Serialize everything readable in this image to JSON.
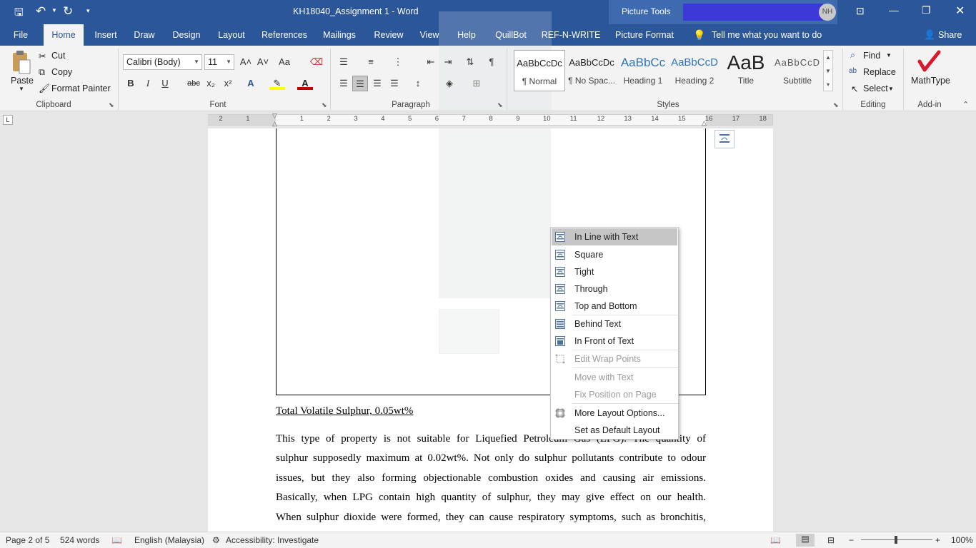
{
  "window": {
    "title": "KH18040_Assignment 1  -  Word",
    "context_tools": "Picture Tools",
    "user_initials": "NH"
  },
  "qat": {
    "save": "save-icon",
    "undo": "undo-icon",
    "redo": "redo-icon"
  },
  "tabs": [
    "File",
    "Home",
    "Insert",
    "Draw",
    "Design",
    "Layout",
    "References",
    "Mailings",
    "Review",
    "View",
    "Help",
    "QuillBot",
    "REF-N-WRITE",
    "Picture Format"
  ],
  "tell_me": "Tell me what you want to do",
  "share": "Share",
  "clipboard": {
    "paste": "Paste",
    "cut": "Cut",
    "copy": "Copy",
    "format_painter": "Format Painter",
    "label": "Clipboard"
  },
  "font": {
    "name": "Calibri (Body)",
    "size": "11",
    "label": "Font",
    "grow": "A˄",
    "shrink": "A˅",
    "case": "Aa",
    "bold": "B",
    "italic": "I",
    "underline": "U",
    "strike": "abc",
    "sub": "x₂",
    "sup": "x²"
  },
  "paragraph": {
    "label": "Paragraph",
    "pilcrow": "¶"
  },
  "styles": {
    "label": "Styles",
    "items": [
      {
        "preview": "AaBbCcDc",
        "name": "¶ Normal"
      },
      {
        "preview": "AaBbCcDc",
        "name": "¶ No Spac..."
      },
      {
        "preview": "AaBbCc",
        "name": "Heading 1"
      },
      {
        "preview": "AaBbCcD",
        "name": "Heading 2"
      },
      {
        "preview": "AaB",
        "name": "Title"
      },
      {
        "preview": "AaBbCcD",
        "name": "Subtitle"
      }
    ]
  },
  "editing": {
    "find": "Find",
    "replace": "Replace",
    "select": "Select",
    "label": "Editing"
  },
  "addin": {
    "mathtype": "MathType",
    "label": "Add-in"
  },
  "ruler": {
    "numbers": [
      "2",
      "1",
      "1",
      "2",
      "3",
      "4",
      "5",
      "6",
      "7",
      "8",
      "9",
      "10",
      "11",
      "12",
      "13",
      "14",
      "15",
      "16",
      "17",
      "18"
    ]
  },
  "document": {
    "caption": "Total Volatile Sulphur, 0.05wt%",
    "lines": [
      "This type of property is not suitable for Liquefied Petroleum Gas (LPG). The quantity of",
      "sulphur supposedly maximum at 0.02wt%. Not only do sulphur pollutants contribute to odour",
      "issues, but they also forming objectionable combustion oxides and causing air emissions.",
      "Basically, when LPG contain high quantity of sulphur, they may give effect on our health.",
      "When sulphur dioxide were formed, they can cause respiratory symptoms, such as bronchitis,"
    ]
  },
  "context_menu": {
    "items": [
      {
        "label": "In Line with Text",
        "enabled": true,
        "icon": "inline-wrap-icon"
      },
      {
        "label": "Square",
        "enabled": true,
        "icon": "square-wrap-icon"
      },
      {
        "label": "Tight",
        "enabled": true,
        "icon": "tight-wrap-icon"
      },
      {
        "label": "Through",
        "enabled": true,
        "icon": "through-wrap-icon"
      },
      {
        "label": "Top and Bottom",
        "enabled": true,
        "icon": "top-bottom-wrap-icon"
      },
      {
        "label": "Behind Text",
        "enabled": true,
        "icon": "behind-text-icon"
      },
      {
        "label": "In Front of Text",
        "enabled": true,
        "icon": "in-front-text-icon"
      },
      {
        "label": "Edit Wrap Points",
        "enabled": false,
        "icon": "edit-wrap-points-icon"
      },
      {
        "label": "Move with Text",
        "enabled": false,
        "icon": ""
      },
      {
        "label": "Fix Position on Page",
        "enabled": false,
        "icon": ""
      },
      {
        "label": "More Layout Options...",
        "enabled": true,
        "icon": "layout-options-icon"
      },
      {
        "label": "Set as Default Layout",
        "enabled": true,
        "icon": ""
      }
    ]
  },
  "status": {
    "page": "Page 2 of 5",
    "words": "524 words",
    "language": "English (Malaysia)",
    "accessibility": "Accessibility: Investigate",
    "zoom": "100%"
  },
  "colors": {
    "brand": "#2b579a",
    "ribbon": "#f3f3f3",
    "canvas": "#e6e6e6",
    "font_color": "#c00000",
    "highlight": "#ffff00",
    "mathtype": "#d9182d"
  }
}
